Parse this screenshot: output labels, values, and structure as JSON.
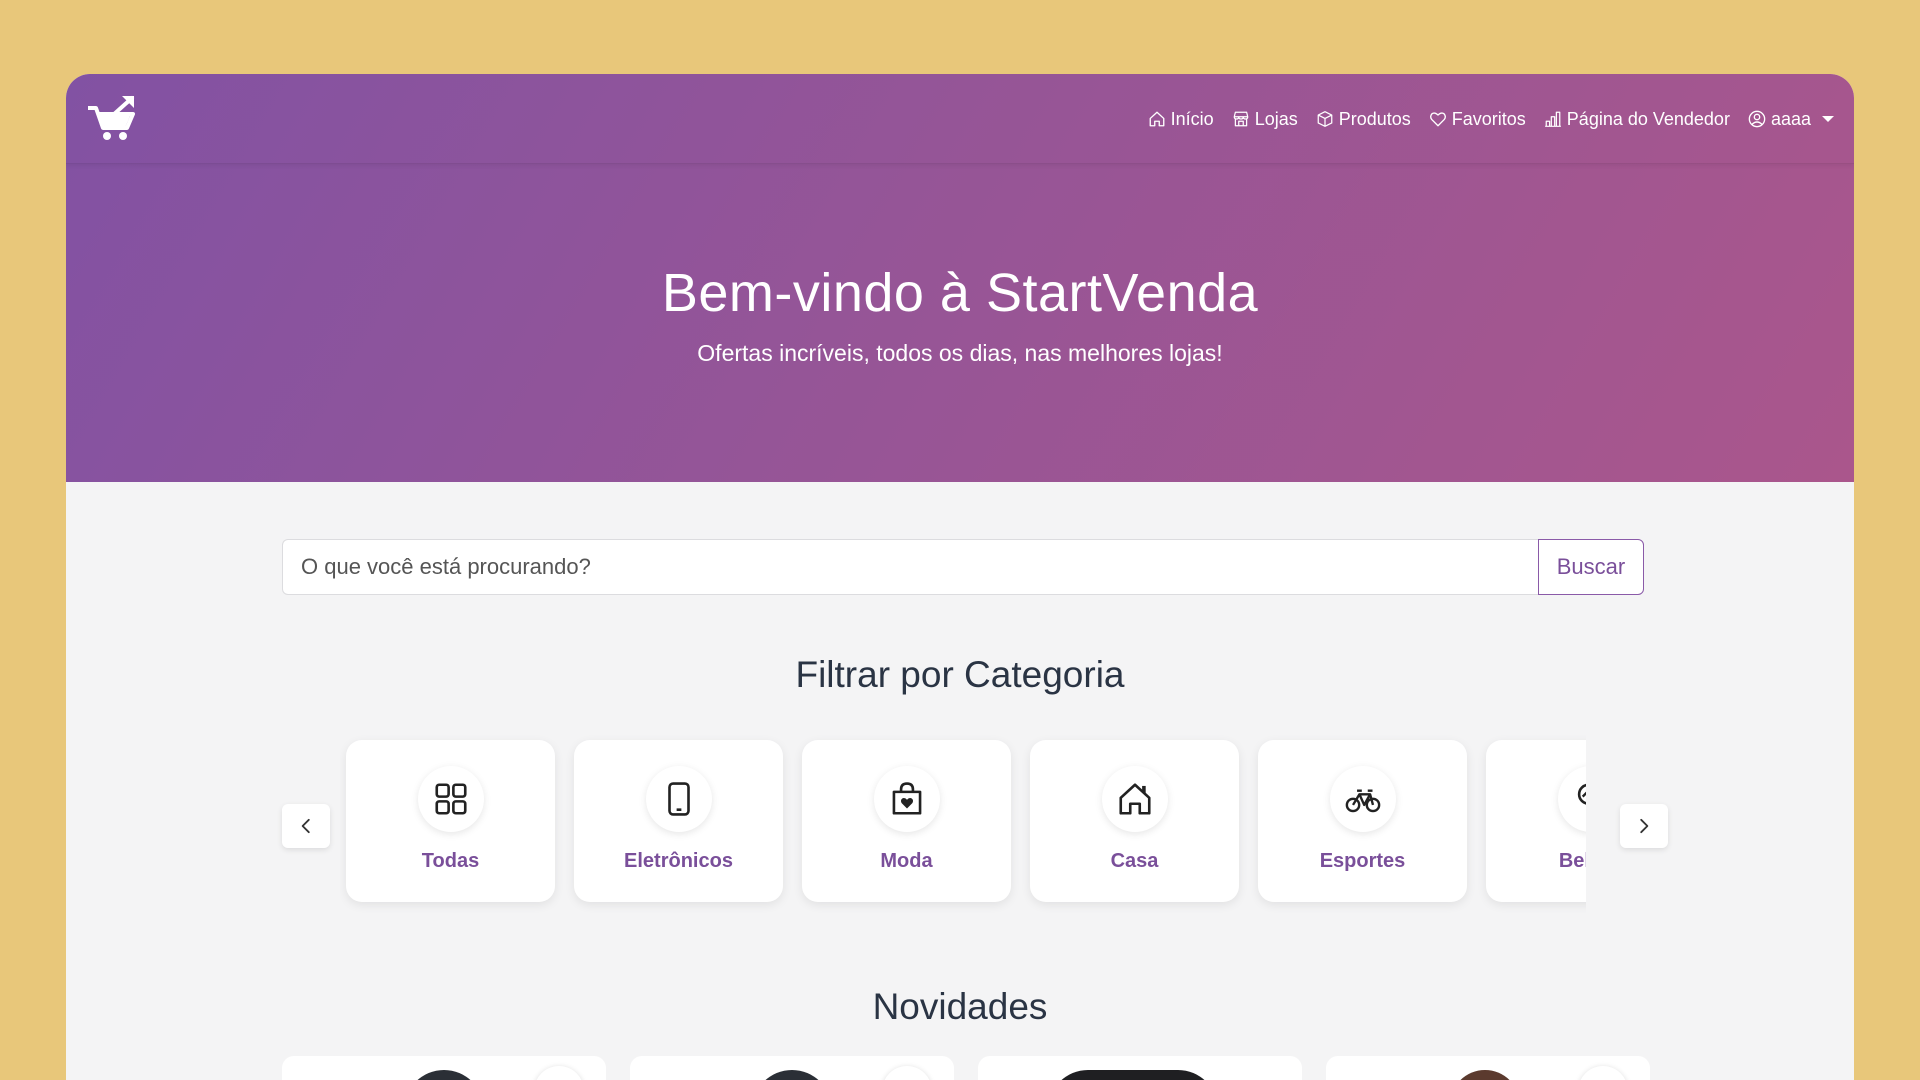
{
  "brand": {
    "logo_icon": "shopping-cart-arrow-icon"
  },
  "nav": {
    "items": [
      {
        "label": "Início",
        "icon": "house-icon"
      },
      {
        "label": "Lojas",
        "icon": "shop-icon"
      },
      {
        "label": "Produtos",
        "icon": "box-icon"
      },
      {
        "label": "Favoritos",
        "icon": "heart-icon"
      },
      {
        "label": "Página do Vendedor",
        "icon": "bar-chart-icon"
      }
    ],
    "user": {
      "label": "aaaa",
      "icon": "person-circle-icon"
    }
  },
  "hero": {
    "title": "Bem-vindo à StartVenda",
    "subtitle": "Ofertas incríveis, todos os dias, nas melhores lojas!"
  },
  "search": {
    "placeholder": "O que você está procurando?",
    "button_label": "Buscar"
  },
  "categories": {
    "title": "Filtrar por Categoria",
    "items": [
      {
        "label": "Todas",
        "icon": "grid-icon"
      },
      {
        "label": "Eletrônicos",
        "icon": "phone-icon"
      },
      {
        "label": "Moda",
        "icon": "bag-heart-icon"
      },
      {
        "label": "Casa",
        "icon": "house-icon"
      },
      {
        "label": "Esportes",
        "icon": "bicycle-icon"
      },
      {
        "label": "Beleza",
        "icon": "beauty-icon"
      }
    ]
  },
  "news": {
    "title": "Novidades"
  },
  "colors": {
    "background": "#E8C77A",
    "hero_start": "#8252a3",
    "hero_end": "#aa568c",
    "accent": "#7a4f9a",
    "heading": "#2a3444"
  }
}
